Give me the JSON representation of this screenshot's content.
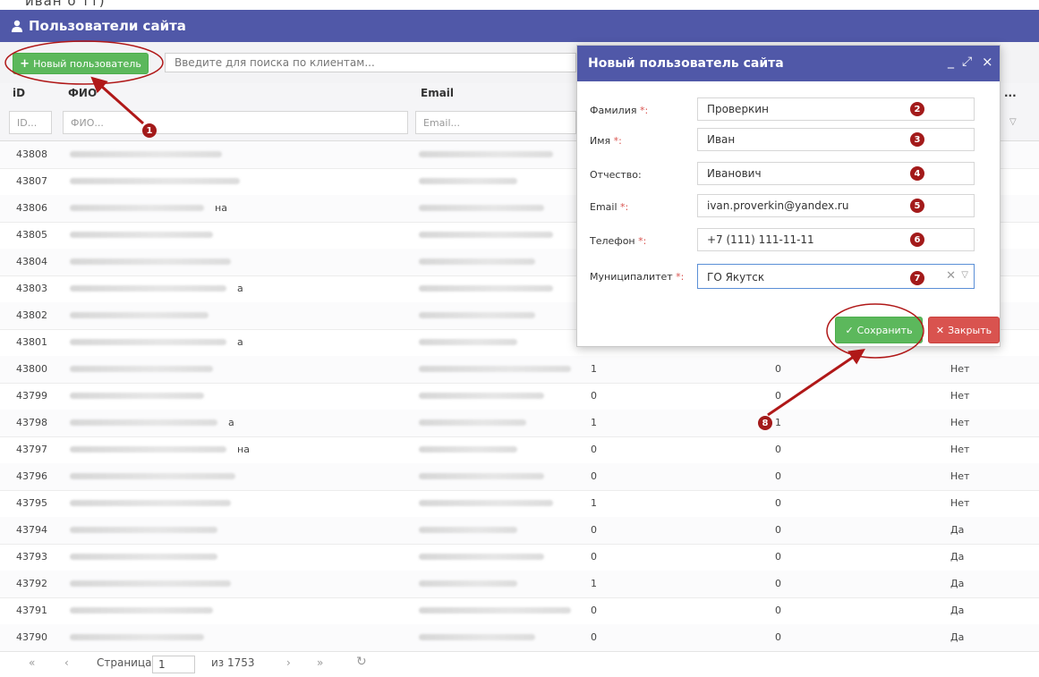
{
  "topline": {
    "text": "иван о тт)"
  },
  "header": {
    "title": "Пользователи сайта",
    "icon": "user-icon"
  },
  "toolbar": {
    "new_button": "Новый пользователь",
    "search_placeholder": "Введите для поиска по клиентам..."
  },
  "table": {
    "columns": [
      "iD",
      "ФИО",
      "Email",
      "..."
    ],
    "filters": {
      "id": "ID...",
      "fio": "ФИО...",
      "email": "Email..."
    },
    "rows": [
      {
        "id": "43808",
        "fio": "",
        "email": "",
        "c4": "",
        "c5": "",
        "c6": ""
      },
      {
        "id": "43807",
        "fio": "",
        "email": "",
        "c4": "",
        "c5": "",
        "c6": ""
      },
      {
        "id": "43806",
        "fio": "на",
        "email": "",
        "c4": "",
        "c5": "",
        "c6": ""
      },
      {
        "id": "43805",
        "fio": "",
        "email": "",
        "c4": "",
        "c5": "",
        "c6": ""
      },
      {
        "id": "43804",
        "fio": "",
        "email": "",
        "c4": "",
        "c5": "",
        "c6": ""
      },
      {
        "id": "43803",
        "fio": "а",
        "email": "",
        "c4": "",
        "c5": "",
        "c6": ""
      },
      {
        "id": "43802",
        "fio": "",
        "email": "",
        "c4": "",
        "c5": "",
        "c6": ""
      },
      {
        "id": "43801",
        "fio": "а",
        "email": "",
        "c4": "",
        "c5": "",
        "c6": ""
      },
      {
        "id": "43800",
        "fio": "",
        "email": "",
        "c4": "1",
        "c5": "0",
        "c6": "Нет"
      },
      {
        "id": "43799",
        "fio": "",
        "email": "",
        "c4": "0",
        "c5": "0",
        "c6": "Нет"
      },
      {
        "id": "43798",
        "fio": "а",
        "email": "",
        "c4": "1",
        "c5": "1",
        "c6": "Нет"
      },
      {
        "id": "43797",
        "fio": "на",
        "email": "",
        "c4": "0",
        "c5": "0",
        "c6": "Нет"
      },
      {
        "id": "43796",
        "fio": "",
        "email": "",
        "c4": "0",
        "c5": "0",
        "c6": "Нет"
      },
      {
        "id": "43795",
        "fio": "",
        "email": "",
        "c4": "1",
        "c5": "0",
        "c6": "Нет"
      },
      {
        "id": "43794",
        "fio": "",
        "email": "",
        "c4": "0",
        "c5": "0",
        "c6": "Да"
      },
      {
        "id": "43793",
        "fio": "",
        "email": "",
        "c4": "0",
        "c5": "0",
        "c6": "Да"
      },
      {
        "id": "43792",
        "fio": "",
        "email": "",
        "c4": "1",
        "c5": "0",
        "c6": "Да"
      },
      {
        "id": "43791",
        "fio": "",
        "email": "",
        "c4": "0",
        "c5": "0",
        "c6": "Да"
      },
      {
        "id": "43790",
        "fio": "",
        "email": "",
        "c4": "0",
        "c5": "0",
        "c6": "Да"
      }
    ]
  },
  "pager": {
    "first": "«",
    "prev": "‹",
    "page_label": "Страница",
    "page": "1",
    "of": "из 1753",
    "next": "›",
    "last": "»",
    "refresh": "↻"
  },
  "modal": {
    "title": "Новый пользователь сайта",
    "controls": {
      "minimize": "_",
      "maximize": "⤢",
      "close": "×"
    },
    "fields": [
      {
        "label": "Фамилия",
        "required": true,
        "value": "Проверкин",
        "marker": "2"
      },
      {
        "label": "Имя",
        "required": true,
        "value": "Иван",
        "marker": "3"
      },
      {
        "label": "Отчество:",
        "required": false,
        "value": "Иванович",
        "marker": "4"
      },
      {
        "label": "Email",
        "required": true,
        "value": "ivan.proverkin@yandex.ru",
        "marker": "5"
      },
      {
        "label": "Телефон",
        "required": true,
        "value": "+7 (111) 111-11-11",
        "marker": "6"
      }
    ],
    "municipality": {
      "label": "Муниципалитет",
      "value": "ГО Якутск",
      "marker": "7"
    },
    "req_mark": " *:",
    "save_button": "Сохранить",
    "close_button": "Закрыть"
  },
  "annotations": {
    "marker1": "1",
    "marker8": "8",
    "arrow_color": "#b01818"
  },
  "colors": {
    "header": "#5058a8",
    "accent_green": "#5cb85c",
    "accent_red": "#d9534f"
  }
}
